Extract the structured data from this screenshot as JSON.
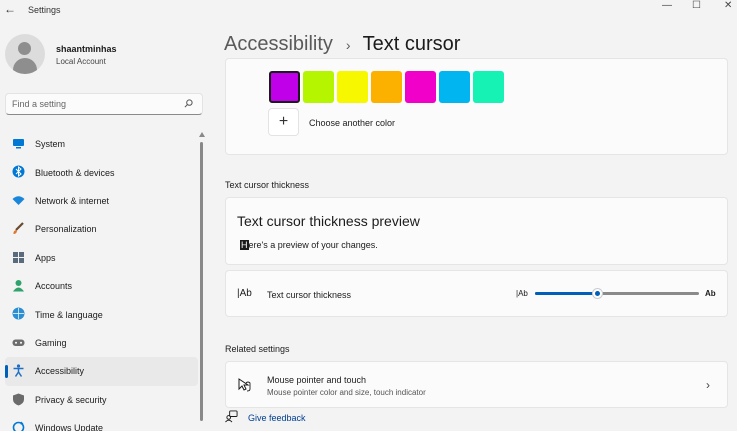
{
  "window": {
    "title": "Settings",
    "back": "←",
    "minimize": "—",
    "maximize": "☐",
    "close": "✕"
  },
  "profile": {
    "name": "shaantminhas",
    "account": "Local Account"
  },
  "search": {
    "placeholder": "Find a setting"
  },
  "nav": [
    {
      "label": "System",
      "icon": "monitor-icon",
      "color": "#0078d4"
    },
    {
      "label": "Bluetooth & devices",
      "icon": "bluetooth-icon",
      "color": "#0078d4"
    },
    {
      "label": "Network & internet",
      "icon": "wifi-icon",
      "color": "#1a86d9"
    },
    {
      "label": "Personalization",
      "icon": "brush-icon",
      "color": "#e3752c"
    },
    {
      "label": "Apps",
      "icon": "apps-icon",
      "color": "#5a6b7d"
    },
    {
      "label": "Accounts",
      "icon": "person-icon",
      "color": "#2fa36b"
    },
    {
      "label": "Time & language",
      "icon": "globe-icon",
      "color": "#2b8fd1"
    },
    {
      "label": "Gaming",
      "icon": "controller-icon",
      "color": "#6d6d6d"
    },
    {
      "label": "Accessibility",
      "icon": "accessibility-icon",
      "color": "#1f6fc5",
      "active": true
    },
    {
      "label": "Privacy & security",
      "icon": "shield-icon",
      "color": "#6b6b6b"
    },
    {
      "label": "Windows Update",
      "icon": "update-icon",
      "color": "#0078d4"
    }
  ],
  "header": {
    "parent": "Accessibility",
    "separator": "›",
    "current": "Text cursor"
  },
  "colors": {
    "swatches": [
      "#c000e8",
      "#b5f500",
      "#f7f700",
      "#fcb100",
      "#f100c9",
      "#00b5f0",
      "#15f2b3"
    ],
    "selected_index": 0,
    "choose_label": "Choose another color",
    "plus": "+"
  },
  "thickness": {
    "section_title": "Text cursor thickness",
    "preview_title": "Text cursor thickness preview",
    "preview_caret": "H",
    "preview_text": "ere's a preview of your changes.",
    "row_icon": "|Ab",
    "row_label": "Text cursor thickness",
    "slider_min_label": "|Ab",
    "slider_max_label": "Ab",
    "slider_value": 0.38
  },
  "related": {
    "section_title": "Related settings",
    "item_title": "Mouse pointer and touch",
    "item_sub": "Mouse pointer color and size, touch indicator",
    "chevron": "›"
  },
  "feedback": {
    "label": "Give feedback"
  }
}
